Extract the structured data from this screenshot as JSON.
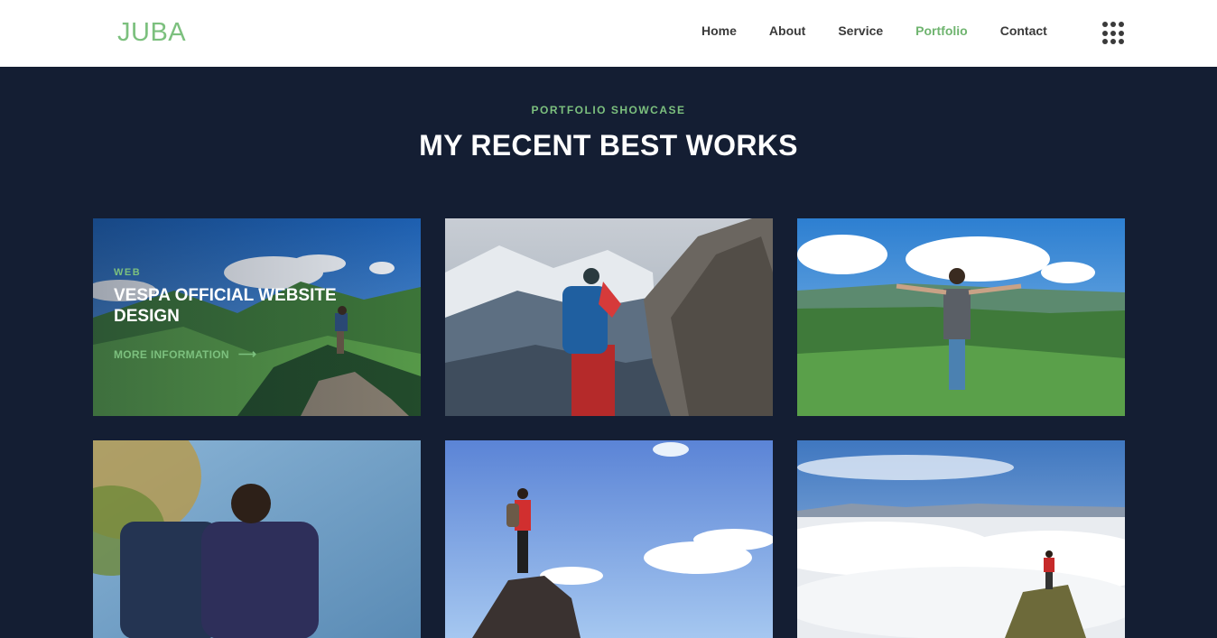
{
  "header": {
    "logo": "JUBA",
    "nav": [
      "Home",
      "About",
      "Service",
      "Portfolio",
      "Contact"
    ],
    "active": "Portfolio",
    "menu_icon": "grid-dots-icon"
  },
  "section": {
    "eyebrow": "PORTFOLIO SHOWCASE",
    "title": "MY RECENT BEST WORKS"
  },
  "portfolio": {
    "featured": {
      "category": "WEB",
      "title": "VESPA OFFICIAL WEBSITE DESIGN",
      "link": "MORE INFORMATION"
    }
  },
  "colors": {
    "accent": "#7cc07e",
    "background": "#141e33"
  }
}
